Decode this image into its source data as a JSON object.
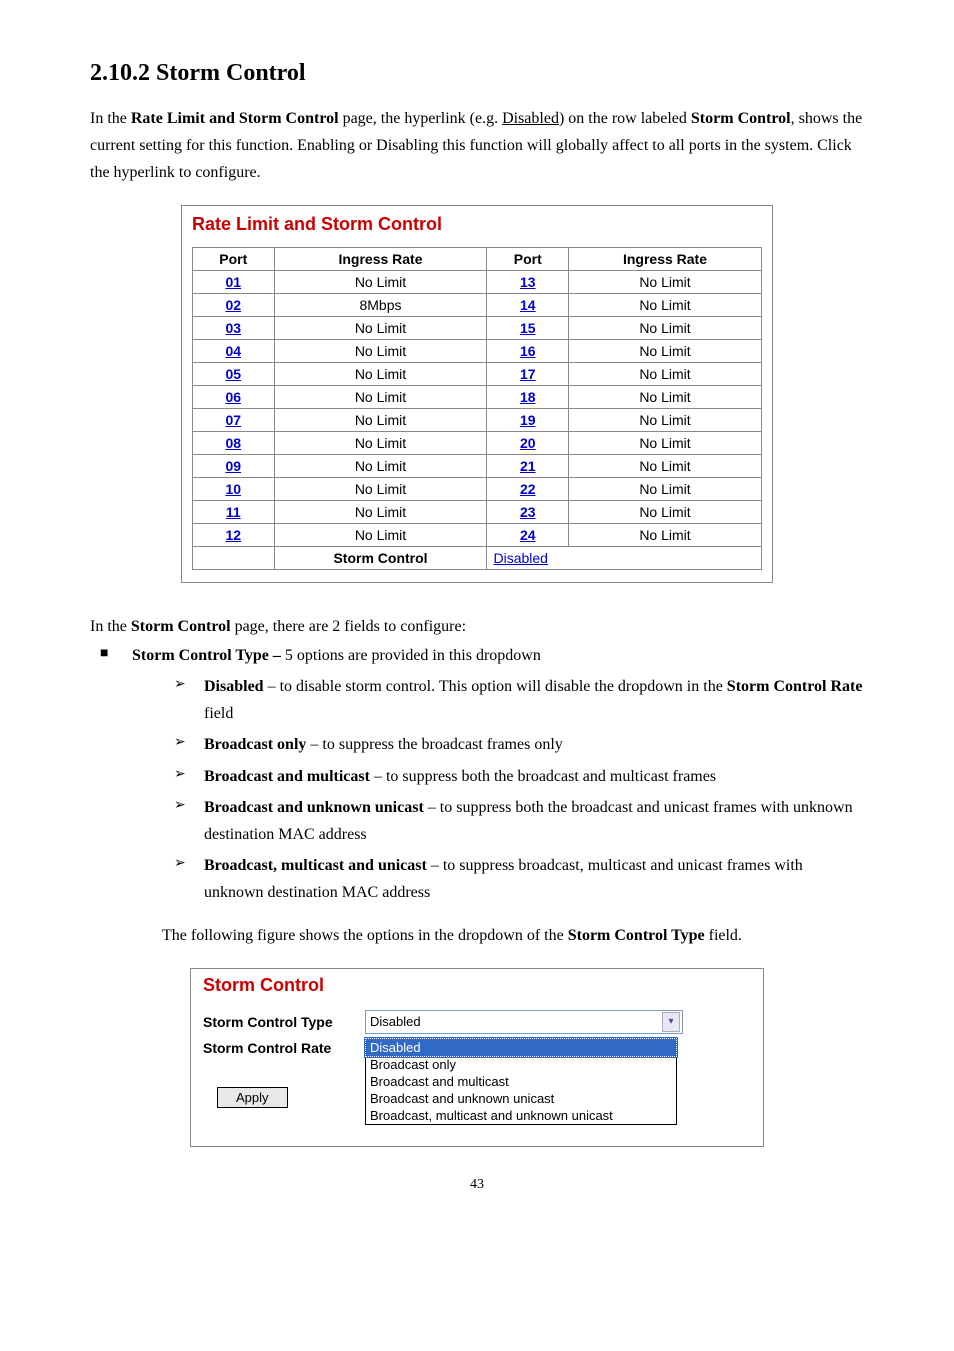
{
  "heading": "2.10.2  Storm Control",
  "intro_parts": {
    "p1_a": "In the ",
    "p1_b": "Rate Limit and Storm Control",
    "p1_c": " page, the hyperlink (e.g. ",
    "p1_d": "Disabled",
    "p1_e": ") on the row labeled ",
    "p1_f": "Storm Control",
    "p1_g": ", shows the current setting for this function. Enabling or Disabling this function will globally affect to all ports in the system. Click the hyperlink to configure."
  },
  "panel1": {
    "title": "Rate Limit and Storm Control",
    "headers": {
      "port": "Port",
      "ingress": "Ingress Rate"
    },
    "rows": [
      {
        "p1": "01",
        "r1": "No Limit",
        "p2": "13",
        "r2": "No Limit"
      },
      {
        "p1": "02",
        "r1": "8Mbps",
        "p2": "14",
        "r2": "No Limit"
      },
      {
        "p1": "03",
        "r1": "No Limit",
        "p2": "15",
        "r2": "No Limit"
      },
      {
        "p1": "04",
        "r1": "No Limit",
        "p2": "16",
        "r2": "No Limit"
      },
      {
        "p1": "05",
        "r1": "No Limit",
        "p2": "17",
        "r2": "No Limit"
      },
      {
        "p1": "06",
        "r1": "No Limit",
        "p2": "18",
        "r2": "No Limit"
      },
      {
        "p1": "07",
        "r1": "No Limit",
        "p2": "19",
        "r2": "No Limit"
      },
      {
        "p1": "08",
        "r1": "No Limit",
        "p2": "20",
        "r2": "No Limit"
      },
      {
        "p1": "09",
        "r1": "No Limit",
        "p2": "21",
        "r2": "No Limit"
      },
      {
        "p1": "10",
        "r1": "No Limit",
        "p2": "22",
        "r2": "No Limit"
      },
      {
        "p1": "11",
        "r1": "No Limit",
        "p2": "23",
        "r2": "No Limit"
      },
      {
        "p1": "12",
        "r1": "No Limit",
        "p2": "24",
        "r2": "No Limit"
      }
    ],
    "footer": {
      "label": "Storm Control",
      "link": "Disabled"
    }
  },
  "mid_parts": {
    "m1_a": "In the ",
    "m1_b": "Storm Control",
    "m1_c": " page, there are 2 fields to configure:"
  },
  "bullets": {
    "b1_a": "Storm Control Type – ",
    "b1_b": "5 options are provided in this dropdown",
    "s1_a": "Disabled",
    "s1_b": " – to disable storm control. This option will disable the dropdown in the ",
    "s1_c": "Storm Control Rate",
    "s1_d": " field",
    "s2_a": "Broadcast only",
    "s2_b": " – to suppress the broadcast frames only",
    "s3_a": "Broadcast and multicast",
    "s3_b": " – to suppress both the broadcast and multicast frames",
    "s4_a": "Broadcast and unknown unicast",
    "s4_b": " – to suppress both the broadcast and unicast frames with unknown destination MAC address",
    "s5_a": "Broadcast, multicast and unicast",
    "s5_b": " – to suppress broadcast, multicast and unicast frames with unknown destination MAC address"
  },
  "followup_a": "The following figure shows the options in the dropdown of the ",
  "followup_b": "Storm Control Type",
  "followup_c": " field.",
  "panel2": {
    "title": "Storm Control",
    "type_label": "Storm Control Type",
    "rate_label": "Storm Control Rate",
    "select_value": "Disabled",
    "options": [
      "Disabled",
      "Broadcast only",
      "Broadcast and multicast",
      "Broadcast and unknown unicast",
      "Broadcast, multicast and unknown unicast"
    ],
    "apply": "Apply"
  },
  "page_number": "43"
}
